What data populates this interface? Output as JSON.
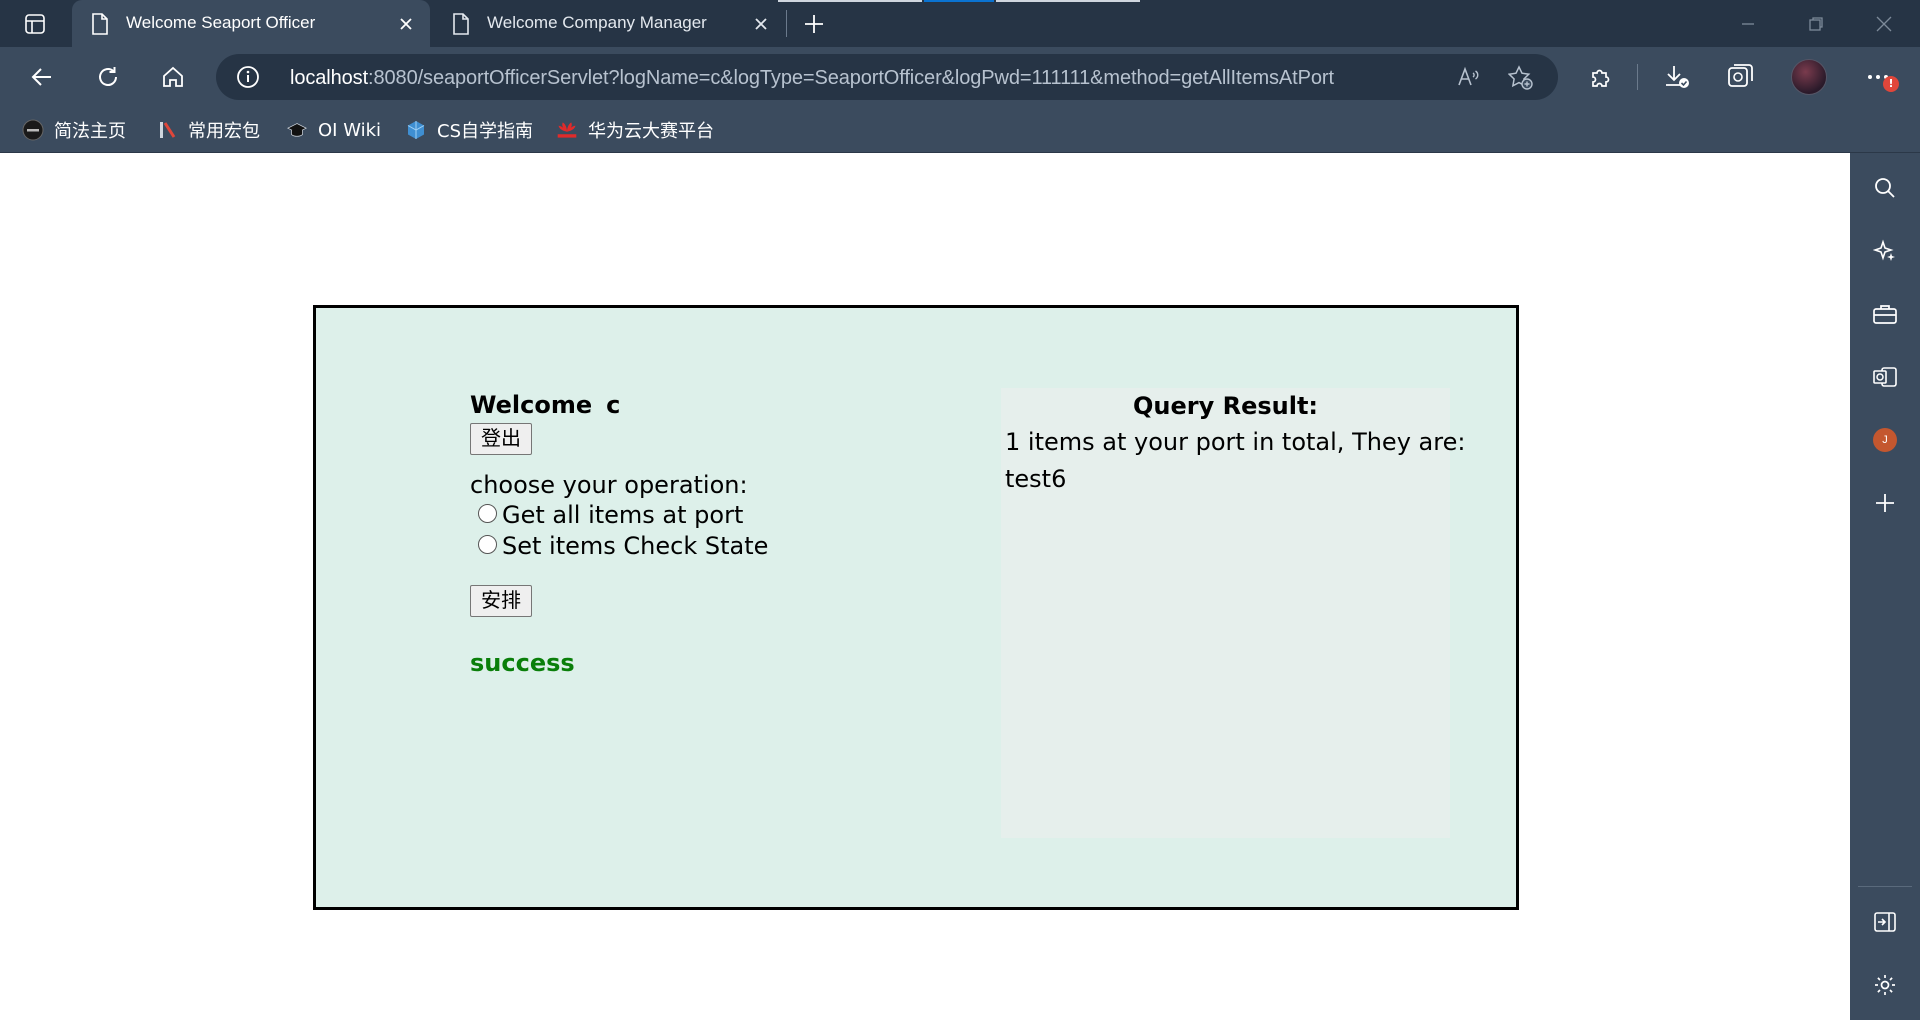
{
  "browser": {
    "tabs": [
      {
        "title": "Welcome Seaport Officer",
        "active": true
      },
      {
        "title": "Welcome Company Manager",
        "active": false
      }
    ],
    "address": {
      "host": "localhost",
      "rest": ":8080/seaportOfficerServlet?logName=c&logType=SeaportOfficer&logPwd=111111&method=getAllItemsAtPort"
    },
    "notification_badge": "!",
    "favorites": [
      {
        "label": "简法主页",
        "icon": "dark-circle-icon"
      },
      {
        "label": "常用宏包",
        "icon": "macro-icon"
      },
      {
        "label": "OI Wiki",
        "icon": "graduation-cap-icon"
      },
      {
        "label": "CS自学指南",
        "icon": "cube-icon"
      },
      {
        "label": "华为云大赛平台",
        "icon": "huawei-icon"
      }
    ],
    "sidebar_avatar_letter": "J",
    "colors": {
      "chrome_dark": "#263445",
      "chrome": "#3b4b5e",
      "accent": "#0a73d1"
    }
  },
  "page": {
    "welcome_label": "Welcome",
    "username": "c",
    "logout_button": "登出",
    "operation_label": "choose your operation:",
    "options": [
      {
        "label": "Get all items at port",
        "checked": false
      },
      {
        "label": "Set items Check State",
        "checked": false
      }
    ],
    "arrange_button": "安排",
    "status_message": "success",
    "colors": {
      "panel_bg": "#ddf0ea",
      "query_bg": "#e6efec",
      "success": "#0a7f0a"
    }
  },
  "query": {
    "title": "Query Result:",
    "summary": "1 items at your port in total, They are:",
    "items": [
      "test6"
    ]
  }
}
